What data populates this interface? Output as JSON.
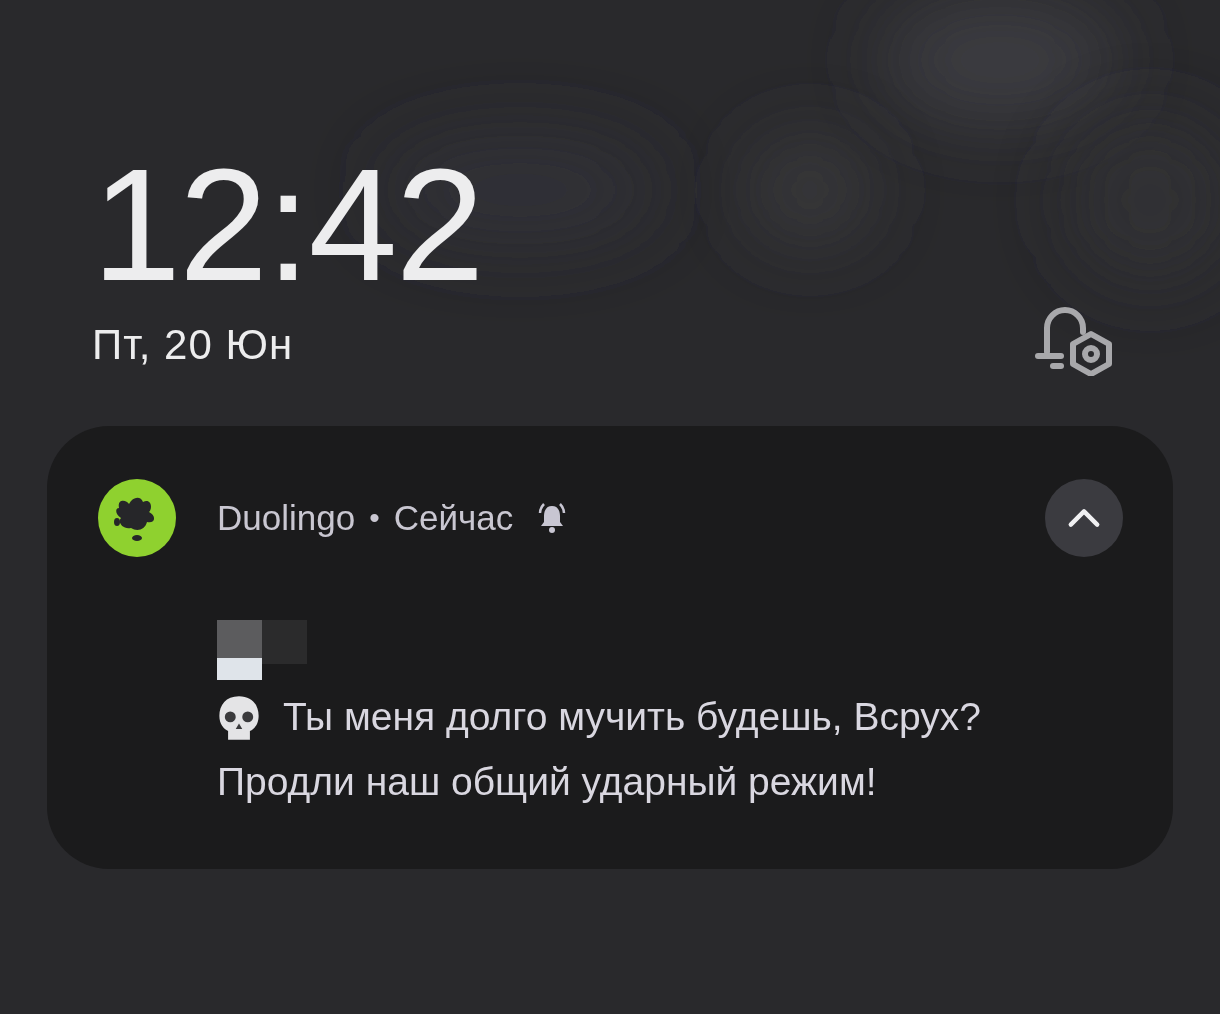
{
  "lock_screen": {
    "time": "12:42",
    "date": "Пт, 20 Юн"
  },
  "notification": {
    "app_name": "Duolingo",
    "separator": "•",
    "time": "Сейчас",
    "alerting": true,
    "expanded": true,
    "message_lines": [
      "Ты меня долго мучить будешь, Всрух?",
      "Продли наш общий ударный режим!"
    ]
  }
}
